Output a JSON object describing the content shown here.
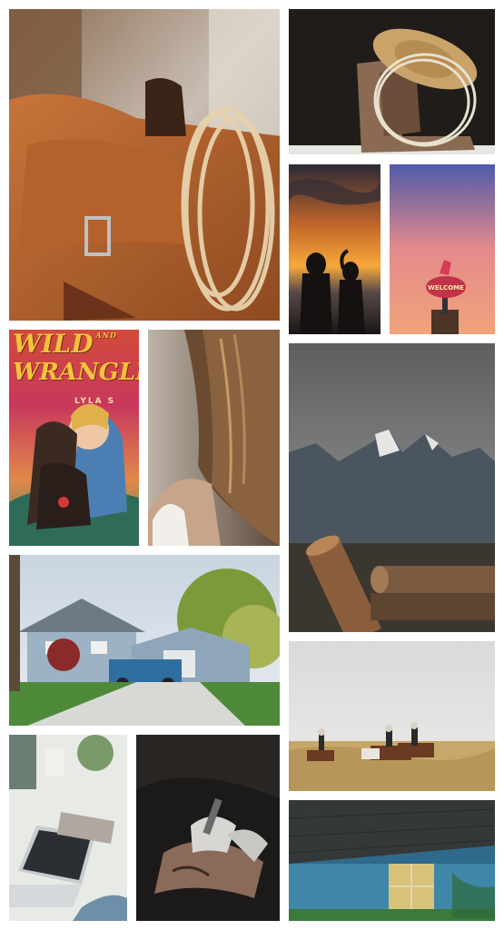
{
  "collage": {
    "tiles": [
      {
        "id": "saddle",
        "subject": "western saddle with coiled rope"
      },
      {
        "id": "boots",
        "subject": "cowboy boots with straw hat and lasso"
      },
      {
        "id": "sunset",
        "subject": "two silhouettes at sunset"
      },
      {
        "id": "sign",
        "subject": "neon welcome sign at dusk"
      },
      {
        "id": "book",
        "subject": "book cover illustration"
      },
      {
        "id": "hair",
        "subject": "woman with long hair"
      },
      {
        "id": "mountain",
        "subject": "mountain range with logs"
      },
      {
        "id": "house",
        "subject": "blue house with pickup truck"
      },
      {
        "id": "riders",
        "subject": "riders on horseback in field"
      },
      {
        "id": "laptop",
        "subject": "laptop on desk with notebook"
      },
      {
        "id": "tattoo",
        "subject": "tattoo artist at work"
      },
      {
        "id": "cabin",
        "subject": "blue cabin with window"
      }
    ],
    "book": {
      "title_word1": "WILD",
      "title_and": "AND",
      "title_word2": "WRANGLE",
      "author": "LYLA S"
    },
    "sign_text": "WELCOME"
  }
}
